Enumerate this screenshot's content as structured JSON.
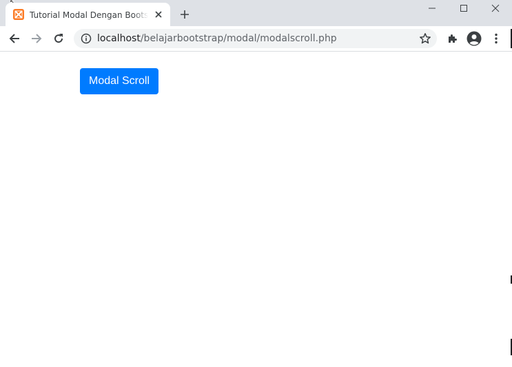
{
  "browser": {
    "tab": {
      "title": "Tutorial Modal Dengan Bootstrap",
      "favicon": "xampp-icon"
    },
    "new_tab_icon": "plus-icon",
    "window_controls": [
      "minimize-icon",
      "maximize-icon",
      "close-icon"
    ],
    "address": {
      "host": "localhost",
      "path": "/belajarbootstrap/modal/modalscroll.php"
    },
    "toolbar_icons": [
      "back-icon",
      "forward-icon",
      "reload-icon",
      "info-icon",
      "star-icon",
      "extensions-icon",
      "profile-icon",
      "menu-icon"
    ]
  },
  "page": {
    "button_label": "Modal Scroll"
  },
  "colors": {
    "primary": "#007bff",
    "tab_strip": "#dee1e6",
    "favicon": "#fb7a24"
  }
}
